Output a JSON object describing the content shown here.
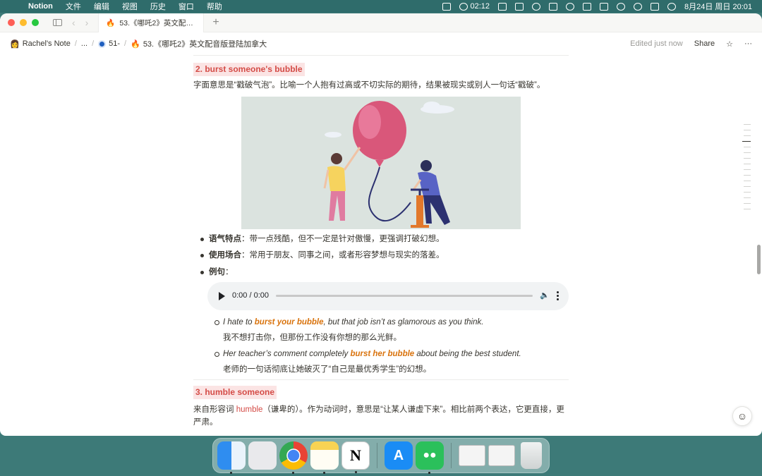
{
  "menubar": {
    "app_name": "Notion",
    "menus": [
      "文件",
      "编辑",
      "视图",
      "历史",
      "窗口",
      "帮助"
    ],
    "timer": "02:12",
    "datetime": "8月24日 周日  20:01"
  },
  "tabbar": {
    "tab_title": "53.《哪吒2》英文配音...",
    "new_tab": "+"
  },
  "topbar": {
    "breadcrumbs": [
      "Rachel's Note",
      "...",
      "51-",
      "53.《哪吒2》英文配音版登陆加拿大"
    ],
    "edited": "Edited just now",
    "share": "Share"
  },
  "section2": {
    "number": "2. ",
    "phrase": "burst someone's bubble",
    "definition": "字面意思是“戳破气泡”。比喻一个人抱有过高或不切实际的期待，结果被现实或别人一句话“戳破”。",
    "tone_label": "语气特点",
    "tone_text": "：带一点残酷，但不一定是针对傲慢，更强调打破幻想。",
    "usage_label": "使用场合",
    "usage_text": "：常用于朋友、同事之间，或者形容梦想与现实的落差。",
    "example_label": "例句",
    "example_colon": "：",
    "audio_time": "0:00 / 0:00",
    "examples": [
      {
        "en_before": "I hate to ",
        "en_highlight": "burst your bubble",
        "en_after": ", but that job isn’t as glamorous as you think.",
        "zh": "我不想打击你，但那份工作没有你想的那么光鲜。"
      },
      {
        "en_before": "Her teacher’s comment completely ",
        "en_highlight": "burst her bubble",
        "en_after": " about being the best student.",
        "zh": "老师的一句话彻底让她破灭了“自己是最优秀学生”的幻想。"
      }
    ]
  },
  "section3": {
    "number": "3. ",
    "phrase": "humble someone",
    "def_before": "来自形容词 ",
    "def_word": "humble",
    "def_after": "（谦卑的）。作为动词时，意思是“让某人谦虚下来”。相比前两个表达，它更直接，更严肃。"
  },
  "colors": {
    "heading_red": "#d44c47",
    "heading_bg": "#fbe4e4",
    "highlight_orange": "#d9730d",
    "desktop": "#3d7a78"
  },
  "dock": {
    "apps": [
      "finder-icon",
      "launchpad-icon",
      "chrome-icon",
      "notes-icon",
      "notion-icon",
      "app-store-icon",
      "wechat-icon",
      "document-icon",
      "document-icon",
      "trash-icon"
    ]
  }
}
